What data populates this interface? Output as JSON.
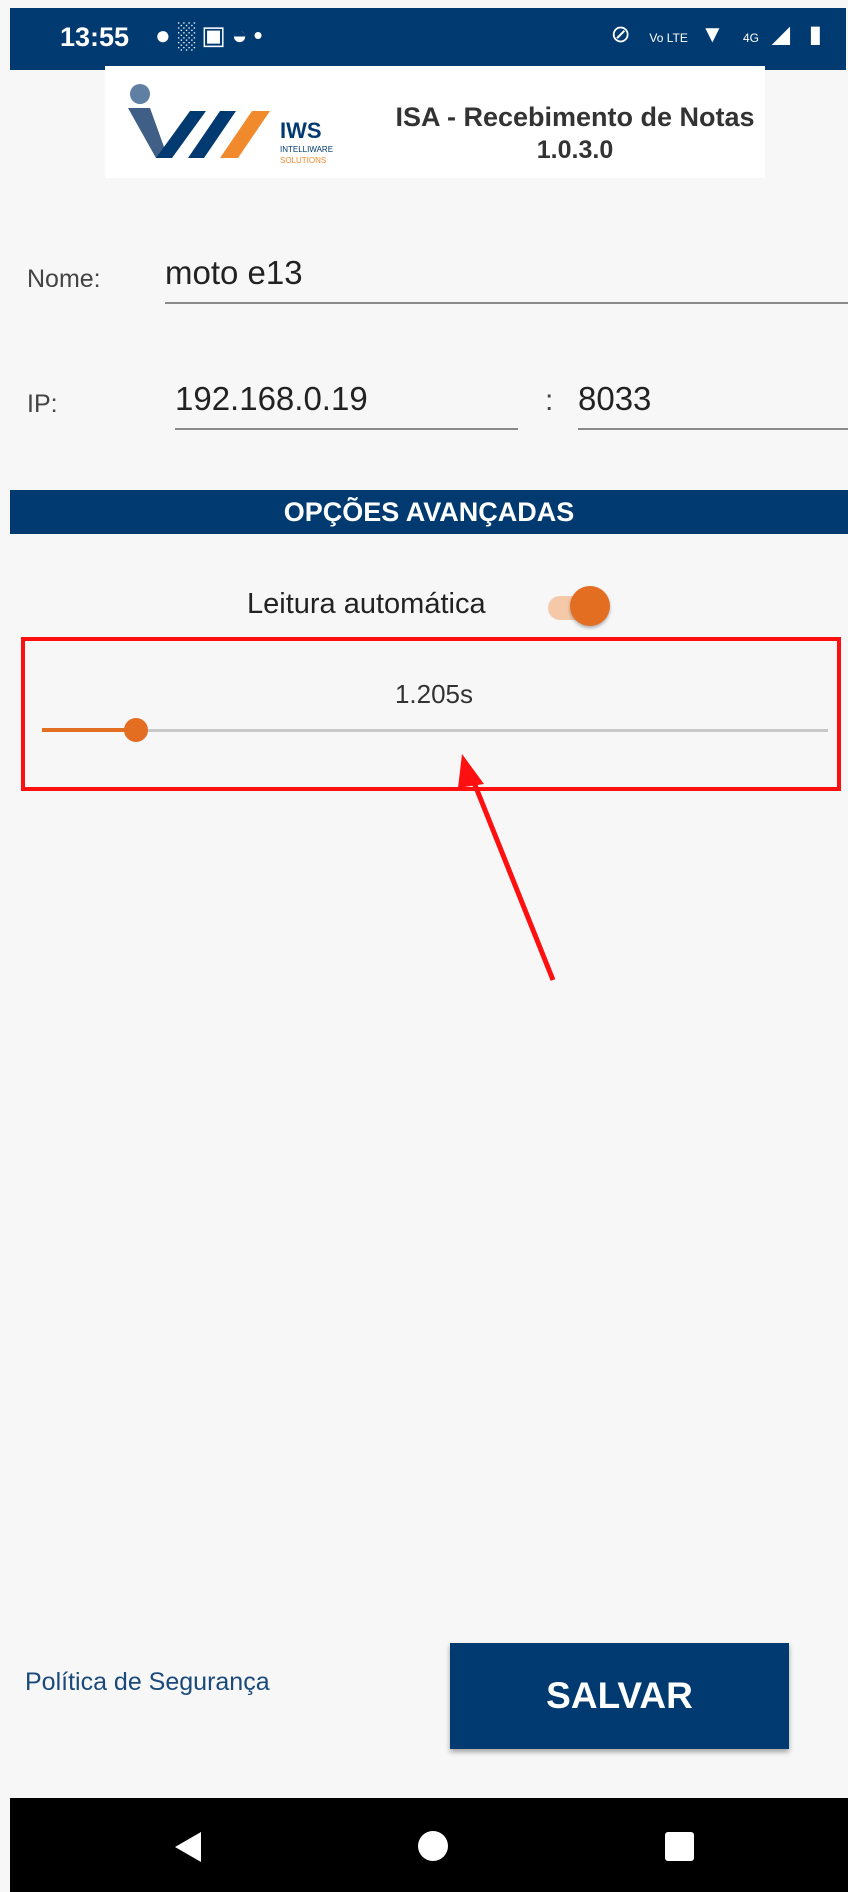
{
  "status_bar": {
    "time": "13:55",
    "left_icons": [
      "chat-icon",
      "signal-unknown-icon",
      "screen-share-icon",
      "speedometer-icon",
      "dot-icon"
    ],
    "right_icons": [
      "mute-icon",
      "volte-icon",
      "wifi-icon",
      "4g-icon",
      "cell-signal-icon",
      "battery-icon"
    ],
    "volte_text": "Vo LTE",
    "network_text": "4G"
  },
  "header": {
    "logo_text": "IWS",
    "logo_subtext_1": "INTELLIWARE",
    "logo_subtext_2": "SOLUTIONS",
    "title": "ISA - Recebimento de Notas",
    "version": "1.0.3.0"
  },
  "form": {
    "name_label": "Nome:",
    "name_value": "moto e13",
    "ip_label": "IP:",
    "ip_value": "192.168.0.19",
    "port_separator": ":",
    "port_value": "8033"
  },
  "advanced": {
    "section_title": "OPÇÕES AVANÇADAS",
    "auto_read_label": "Leitura automática",
    "auto_read_enabled": true,
    "slider_value_text": "1.205s",
    "slider_fraction": 0.12
  },
  "footer": {
    "policy_link": "Política de Segurança",
    "save_label": "SALVAR"
  },
  "colors": {
    "primary": "#003a70",
    "accent": "#e36e22",
    "highlight": "#ff1010"
  }
}
